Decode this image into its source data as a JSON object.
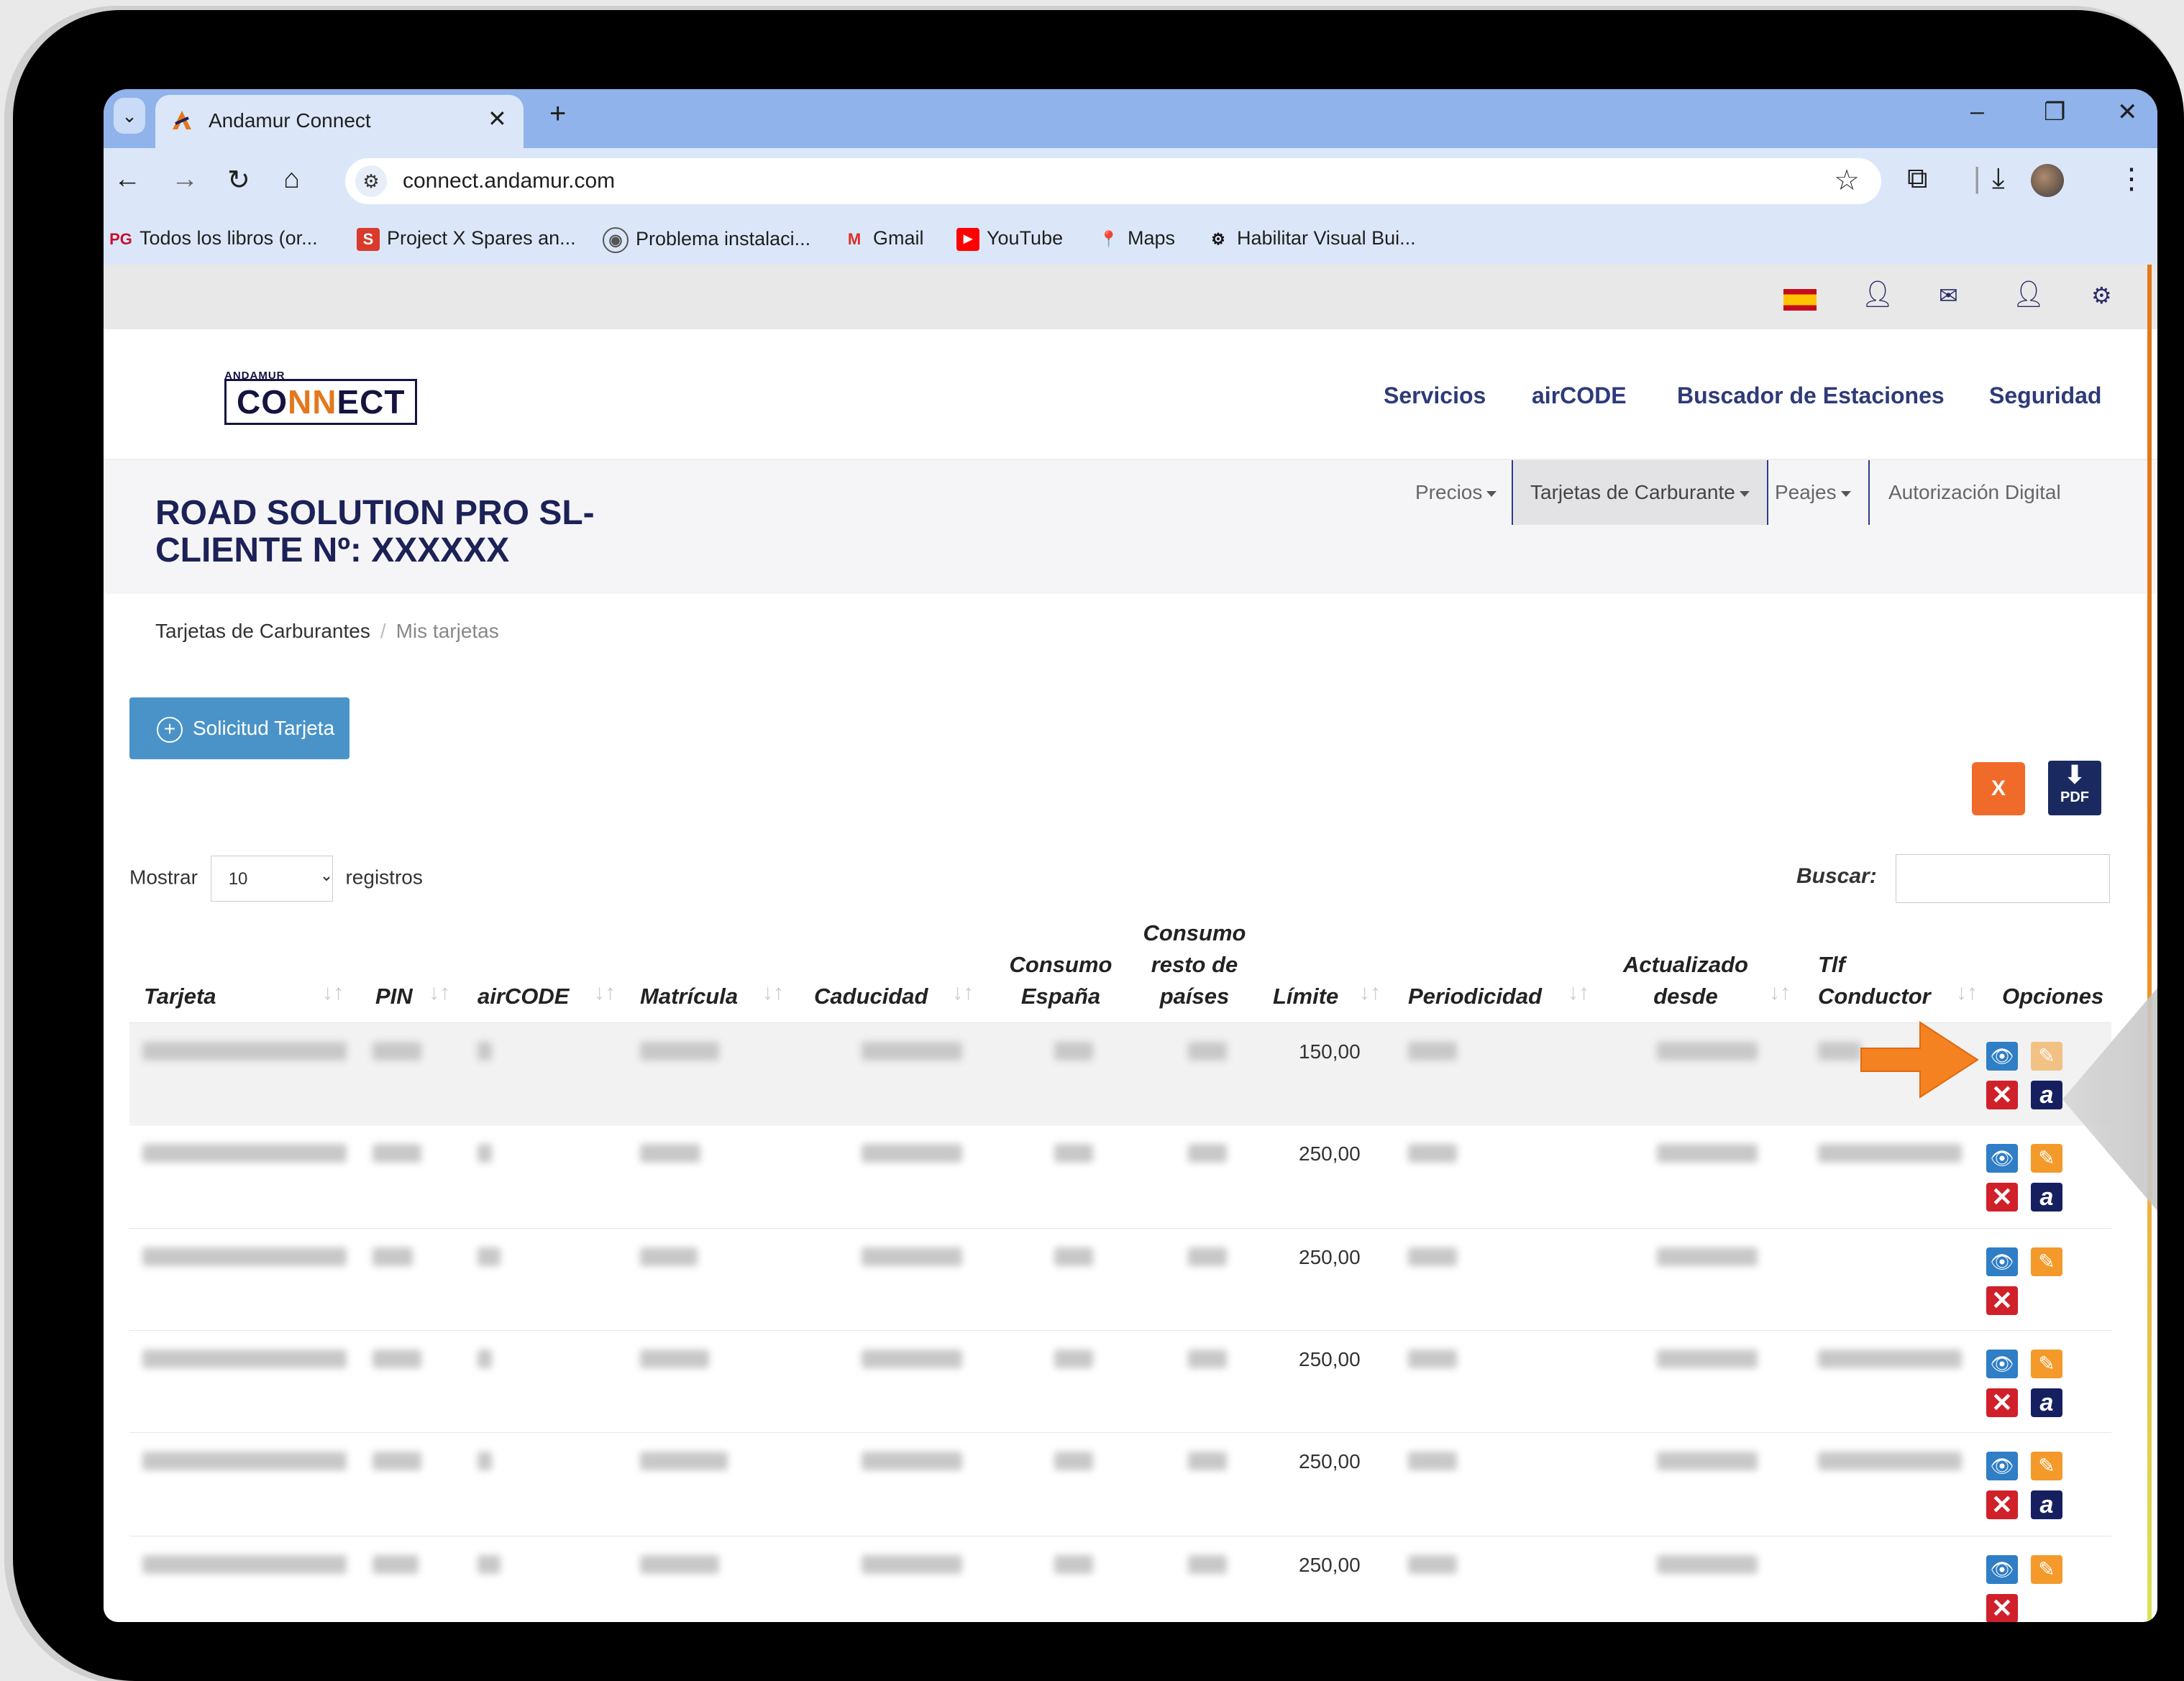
{
  "browser": {
    "tab_title": "Andamur Connect",
    "new_tab": "+",
    "url": "connect.andamur.com",
    "window_controls": {
      "minimize": "–",
      "restore": "❐",
      "close": "✕"
    },
    "bookmarks": [
      {
        "label": "Todos los libros (or...",
        "icon": "PG"
      },
      {
        "label": "Project X Spares an...",
        "icon": "S"
      },
      {
        "label": "Problema instalaci...",
        "icon": "◉"
      },
      {
        "label": "Gmail",
        "icon": "M"
      },
      {
        "label": "YouTube",
        "icon": "▶"
      },
      {
        "label": "Maps",
        "icon": "📍"
      },
      {
        "label": "Habilitar Visual Bui...",
        "icon": "⚙"
      }
    ]
  },
  "site": {
    "logo_small": "ANDAMUR",
    "logo_main_a": "CO",
    "logo_main_b": "NN",
    "logo_main_c": "ECT",
    "nav": [
      "Servicios",
      "airCODE",
      "Buscador de Estaciones",
      "Seguridad"
    ],
    "client_line1": "ROAD SOLUTION PRO SL-",
    "client_line2": "CLIENTE Nº: XXXXXX",
    "subnav": [
      "Precios",
      "Tarjetas de Carburante",
      "Peajes",
      "Autorización Digital"
    ],
    "breadcrumb": [
      "Tarjetas de Carburantes",
      "Mis tarjetas"
    ],
    "request_button": "Solicitud Tarjeta",
    "excel_label": "X",
    "pdf_label": "PDF",
    "show_prefix": "Mostrar",
    "show_value": "10",
    "show_suffix": "registros",
    "search_label": "Buscar:",
    "search_value": ""
  },
  "table": {
    "headers": {
      "tarjeta": "Tarjeta",
      "pin": "PIN",
      "aircode": "airCODE",
      "matricula": "Matrícula",
      "caducidad": "Caducidad",
      "consumo_es_1": "Consumo",
      "consumo_es_2": "España",
      "consumo_resto_1": "Consumo",
      "consumo_resto_2": "resto de",
      "consumo_resto_3": "países",
      "limite": "Límite",
      "periodicidad": "Periodicidad",
      "actualizado_1": "Actualizado",
      "actualizado_2": "desde",
      "tlf_1": "Tlf",
      "tlf_2": "Conductor",
      "opciones": "Opciones"
    },
    "rows": [
      {
        "limite": "150,00",
        "has_phone": true,
        "has_aircode": true
      },
      {
        "limite": "250,00",
        "has_phone": true,
        "has_aircode": true
      },
      {
        "limite": "250,00",
        "has_phone": false,
        "has_aircode": false
      },
      {
        "limite": "250,00",
        "has_phone": true,
        "has_aircode": true
      },
      {
        "limite": "250,00",
        "has_phone": true,
        "has_aircode": true
      },
      {
        "limite": "250,00",
        "has_phone": false,
        "has_aircode": false
      }
    ]
  },
  "colors": {
    "brand_navy": "#1c2257",
    "brand_orange": "#e4781c",
    "button_blue": "#4a93c8",
    "annotation_arrow": "#f58220"
  }
}
